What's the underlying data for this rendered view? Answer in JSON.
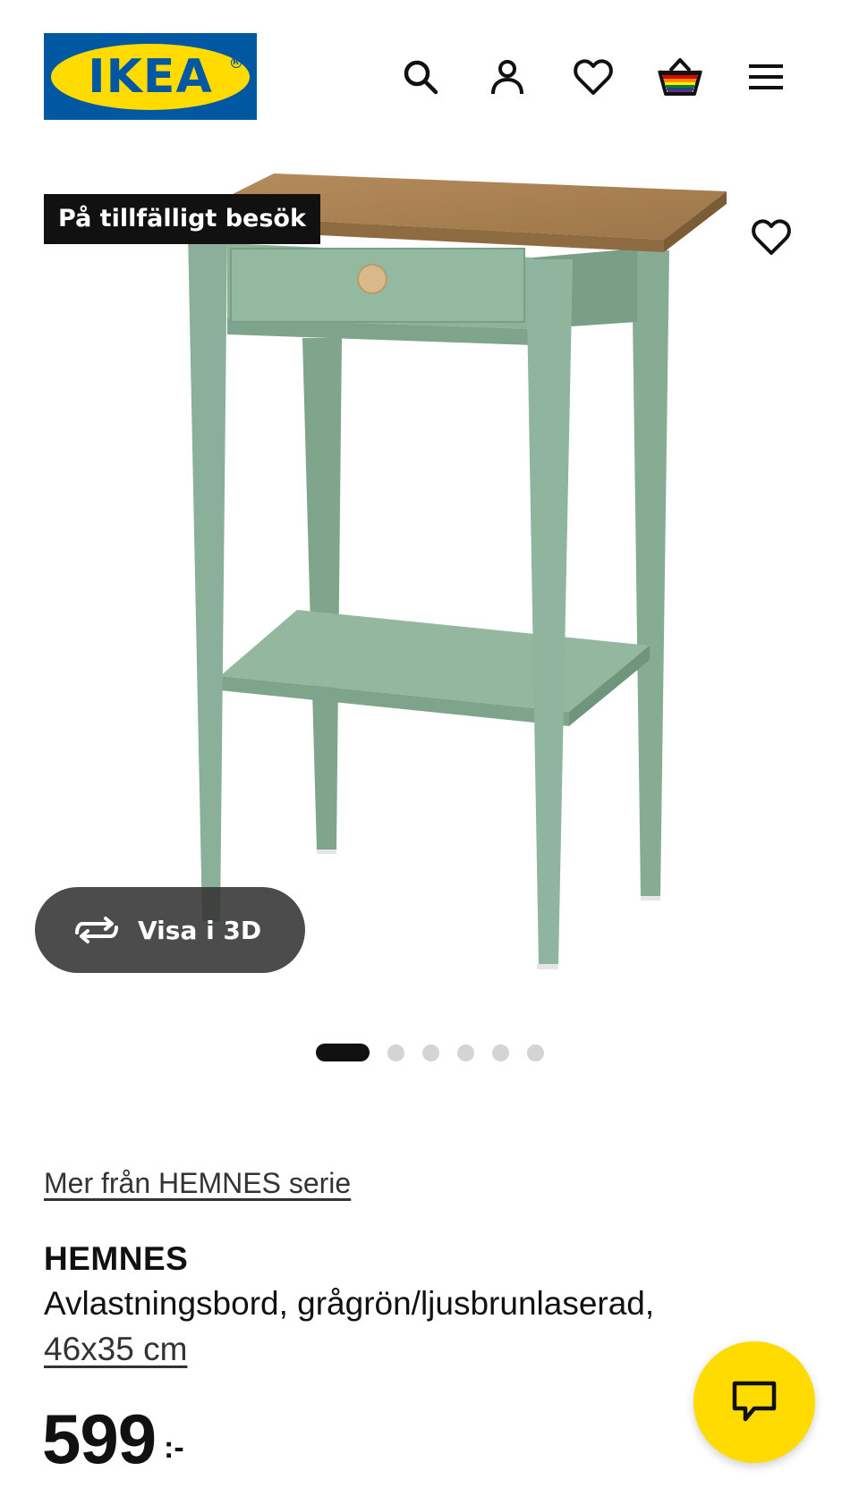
{
  "header": {
    "logo_text": "IKEA",
    "icons": [
      "search-icon",
      "account-icon",
      "heart-icon",
      "basket-icon",
      "menu-icon"
    ]
  },
  "product_image": {
    "badge": "På tillfälligt besök",
    "view_3d_label": "Visa i 3D",
    "carousel": {
      "total": 6,
      "active_index": 0
    }
  },
  "product": {
    "series_link": "Mer från HEMNES serie",
    "name": "HEMNES",
    "description": "Avlastningsbord, grågrön/ljusbrunlaserad,",
    "size": "46x35 cm",
    "price_integer": "599",
    "price_suffix": ":-"
  },
  "colors": {
    "brand_blue": "#0058a3",
    "brand_yellow": "#ffdb00",
    "table_green": "#8fb39b",
    "table_wood": "#b08a5a"
  }
}
